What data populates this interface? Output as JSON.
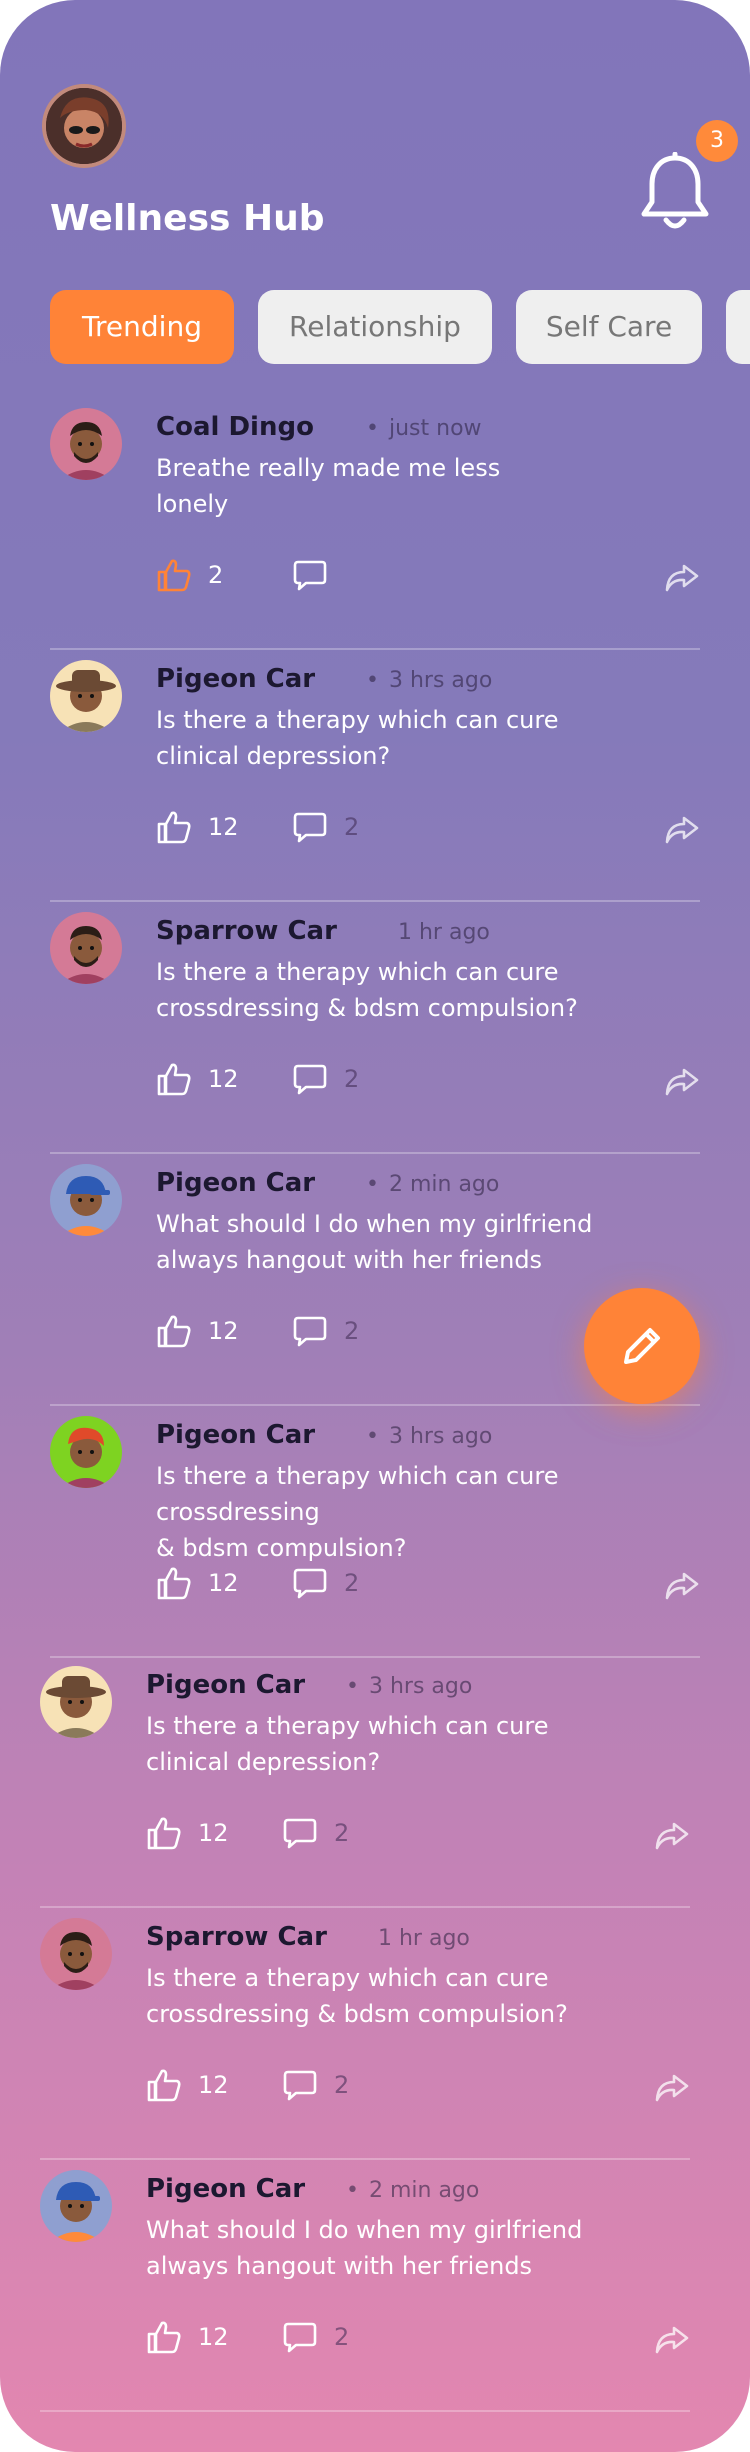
{
  "app": {
    "title": "Wellness Hub"
  },
  "notifications": {
    "count": "3"
  },
  "tabs": [
    {
      "label": "Trending"
    },
    {
      "label": "Relationship"
    },
    {
      "label": "Self Care"
    },
    {
      "label": ""
    }
  ],
  "posts": [
    {
      "name": "Coal Dingo",
      "separator": "•",
      "time": "just now",
      "text": "Breathe really made me less\n lonely",
      "likes": "2",
      "comments": "",
      "avatar": "man-beard-pink"
    },
    {
      "name": "Pigeon Car",
      "separator": "•",
      "time": "3 hrs ago",
      "text": "Is there a therapy which can cure\nclinical depression?",
      "likes": "12",
      "comments": "2",
      "avatar": "man-hat-cream"
    },
    {
      "name": "Sparrow Car",
      "separator": "",
      "time": "1 hr ago",
      "text": "Is there a therapy which can cure\ncrossdressing & bdsm compulsion?",
      "likes": "12",
      "comments": "2",
      "avatar": "man-beard-pink"
    },
    {
      "name": "Pigeon Car",
      "separator": "•",
      "time": "2 min ago",
      "text": "What should I do when my girlfriend\nalways hangout with her friends",
      "likes": "12",
      "comments": "2",
      "avatar": "boy-cap-blue"
    },
    {
      "name": "Pigeon Car",
      "separator": "•",
      "time": "3 hrs ago",
      "text": "Is there a therapy which can cure crossdressing\n& bdsm compulsion?",
      "likes": "12",
      "comments": "2",
      "avatar": "redhead-green"
    },
    {
      "name": "Pigeon Car",
      "separator": "•",
      "time": "3 hrs ago",
      "text": "Is there a therapy which can cure\nclinical depression?",
      "likes": "12",
      "comments": "2",
      "avatar": "man-hat-cream"
    },
    {
      "name": "Sparrow Car",
      "separator": "",
      "time": "1 hr ago",
      "text": "Is there a therapy which can cure\ncrossdressing & bdsm compulsion?",
      "likes": "12",
      "comments": "2",
      "avatar": "man-beard-pink"
    },
    {
      "name": "Pigeon Car",
      "separator": "•",
      "time": "2 min ago",
      "text": "What should I do when my girlfriend\nalways hangout with her friends",
      "likes": "12",
      "comments": "2",
      "avatar": "boy-cap-blue"
    }
  ],
  "icons": {
    "bell": "bell-icon",
    "like": "thumbs-up-icon",
    "comment": "comment-icon",
    "share": "share-icon",
    "compose": "pencil-icon"
  },
  "colors": {
    "accent": "#ff8337",
    "text_dark": "#1c1830"
  }
}
